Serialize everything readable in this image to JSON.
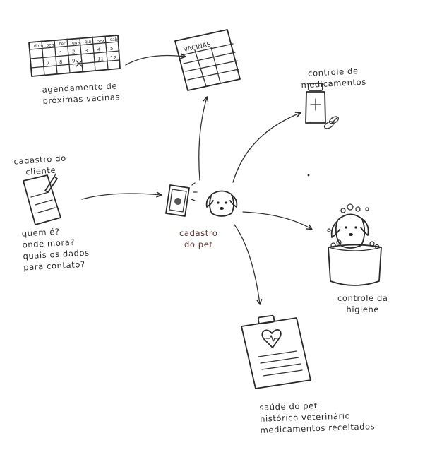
{
  "nodes": {
    "agendamento": {
      "lines": [
        "agendamento de",
        "próximas vacinas"
      ]
    },
    "vacinas": {
      "title": "VACINAS"
    },
    "medicamentos": {
      "lines": [
        "controle de",
        "medicamentos"
      ]
    },
    "cliente": {
      "title_lines": [
        "cadastro do",
        "cliente"
      ],
      "question_lines": [
        "quem é?",
        "onde mora?",
        "quais os dados",
        "para contato?"
      ]
    },
    "pet": {
      "lines": [
        "cadastro",
        "do pet"
      ]
    },
    "higiene": {
      "lines": [
        "controle da",
        "higiene"
      ]
    },
    "saude": {
      "lines": [
        "saúde do pet",
        "histórico veterinário",
        "medicamentos receitados"
      ]
    }
  },
  "calendar": {
    "weekdays": [
      "dom",
      "seg",
      "ter",
      "qua",
      "qui",
      "sex",
      "sab"
    ],
    "rows": [
      [
        "",
        "",
        "1",
        "2",
        "3",
        "4",
        "5"
      ],
      [
        "",
        "7",
        "8",
        "9",
        "",
        "11",
        "12",
        "13"
      ]
    ]
  }
}
